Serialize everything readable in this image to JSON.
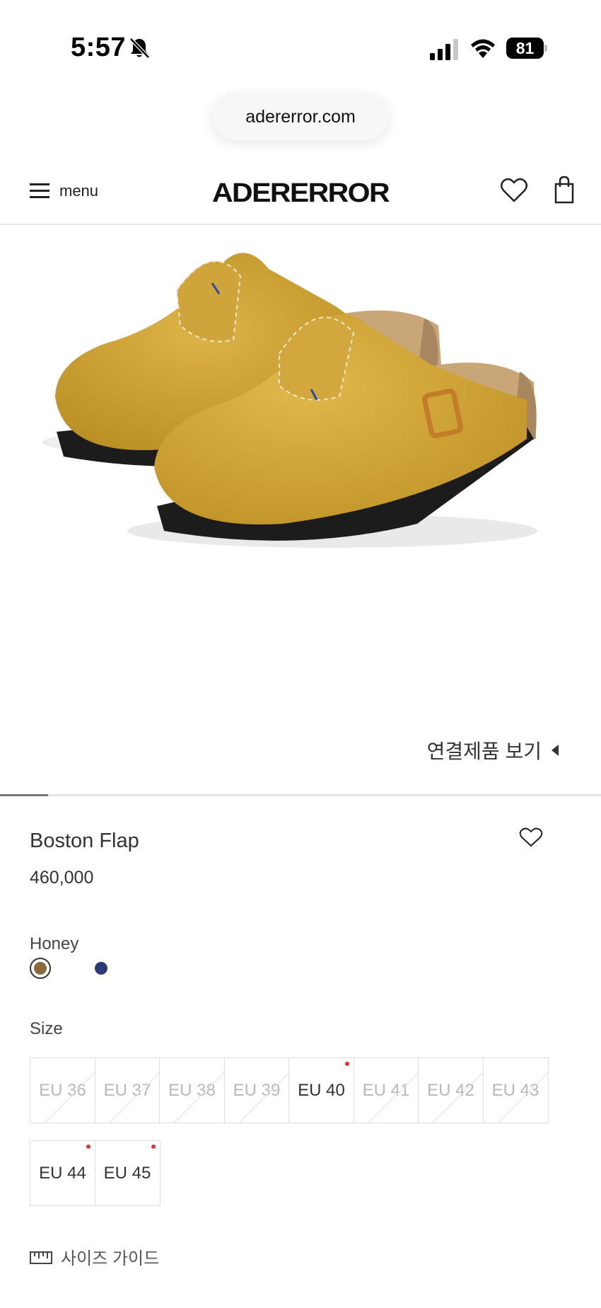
{
  "status_bar": {
    "time": "5:57",
    "battery": "81"
  },
  "browser": {
    "url": "adererror.com"
  },
  "header": {
    "menu_label": "menu",
    "logo": "ADERERROR"
  },
  "product": {
    "linked_products_label": "연결제품 보기",
    "name": "Boston Flap",
    "price": "460,000",
    "selected_color": "Honey",
    "colors": [
      {
        "name": "Honey",
        "hex": "#8a6a3a"
      },
      {
        "name": "Navy",
        "hex": "#2c3a78"
      }
    ],
    "image_slider_progress": 0.08
  },
  "size": {
    "label": "Size",
    "rows": [
      [
        {
          "label": "EU 36",
          "available": false
        },
        {
          "label": "EU 37",
          "available": false
        },
        {
          "label": "EU 38",
          "available": false
        },
        {
          "label": "EU 39",
          "available": false
        },
        {
          "label": "EU 40",
          "available": true
        },
        {
          "label": "EU 41",
          "available": false
        },
        {
          "label": "EU 42",
          "available": false
        },
        {
          "label": "EU 43",
          "available": false
        }
      ],
      [
        {
          "label": "EU 44",
          "available": true
        },
        {
          "label": "EU 45",
          "available": true
        }
      ]
    ],
    "guide_label": "사이즈 가이드"
  },
  "colors": {
    "accent_dot": "#e33333",
    "shoe": "#d4a838"
  }
}
